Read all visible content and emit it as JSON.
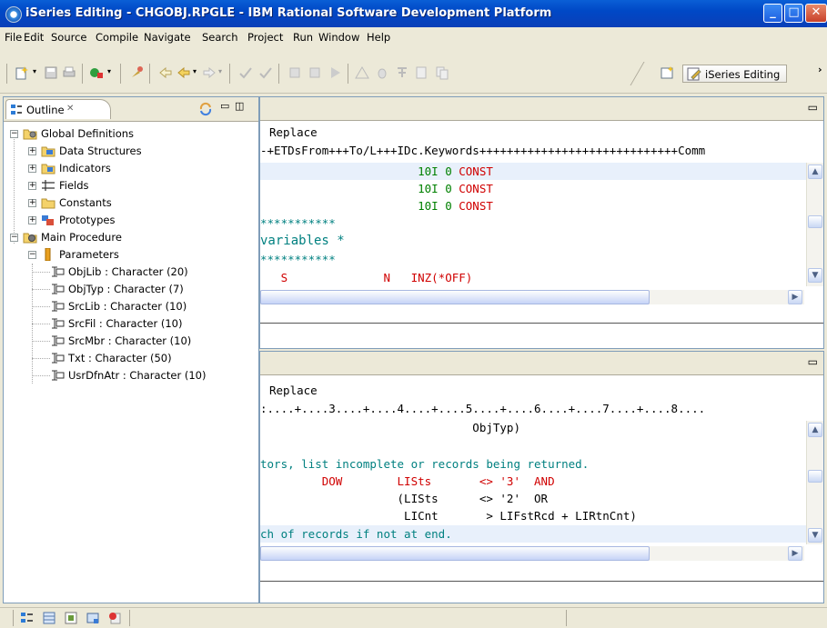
{
  "window": {
    "title": "iSeries Editing - CHGOBJ.RPGLE - IBM Rational Software Development Platform"
  },
  "menu": [
    "File",
    "Edit",
    "Source",
    "Compile",
    "Navigate",
    "Search",
    "Project",
    "Run",
    "Window",
    "Help"
  ],
  "perspective": {
    "label": "iSeries Editing"
  },
  "outline": {
    "tab_label": "Outline",
    "close_glyph": "✕",
    "tree": [
      {
        "label": "Global Definitions",
        "icon": "globe-gear-icon",
        "expanded": true
      },
      {
        "label": "Data Structures",
        "icon": "folder-icon"
      },
      {
        "label": "Indicators",
        "icon": "folder-indicator-icon"
      },
      {
        "label": "Fields",
        "icon": "fields-icon"
      },
      {
        "label": "Constants",
        "icon": "folder-icon"
      },
      {
        "label": "Prototypes",
        "icon": "prototype-icon"
      },
      {
        "label": "Main Procedure",
        "icon": "procedure-gear-icon",
        "expanded": true
      },
      {
        "label": "Parameters",
        "icon": "parameters-icon",
        "expanded": true
      },
      {
        "label": "ObjLib : Character (20)",
        "icon": "parameter-icon"
      },
      {
        "label": "ObjTyp : Character (7)",
        "icon": "parameter-icon"
      },
      {
        "label": "SrcLib : Character (10)",
        "icon": "parameter-icon"
      },
      {
        "label": "SrcFil : Character (10)",
        "icon": "parameter-icon"
      },
      {
        "label": "SrcMbr : Character (10)",
        "icon": "parameter-icon"
      },
      {
        "label": "Txt : Character (50)",
        "icon": "parameter-icon"
      },
      {
        "label": "UsrDfnAtr : Character (10)",
        "icon": "parameter-icon"
      }
    ]
  },
  "editor1": {
    "mode": "Replace",
    "ruler": "-+ETDsFrom+++To/L+++IDc.Keywords+++++++++++++++++++++++++++++Comm",
    "lines": [
      {
        "a": "                       ",
        "b": "10I 0",
        "c": " CONST"
      },
      {
        "a": "                       ",
        "b": "10I 0",
        "c": " CONST"
      },
      {
        "a": "                       ",
        "b": "10I 0",
        "c": " CONST"
      },
      {
        "a": "***********",
        "b": "",
        "c": ""
      },
      {
        "a": "variables *",
        "b": "",
        "c": ""
      },
      {
        "a": "***********",
        "b": "",
        "c": ""
      },
      {
        "a": "   S              N   ",
        "b": "",
        "c": "INZ(*OFF)"
      }
    ]
  },
  "editor2": {
    "mode": "Replace",
    "ruler": ":....+....3....+....4....+....5....+....6....+....7....+....8....",
    "lines": [
      "                               ObjTyp)",
      "",
      "tors, list incomplete or records being returned.",
      "         DOW        LISts       <> '3'  AND",
      "                    (LISts      <> '2'  OR",
      "                     LICnt       > LIFstRcd + LIRtnCnt)",
      "ch of records if not at end."
    ]
  },
  "colors": {
    "titlebar": "#0a5fd6",
    "keyword_red": "#d00000",
    "comment_teal": "#008080",
    "number_green": "#008000"
  }
}
